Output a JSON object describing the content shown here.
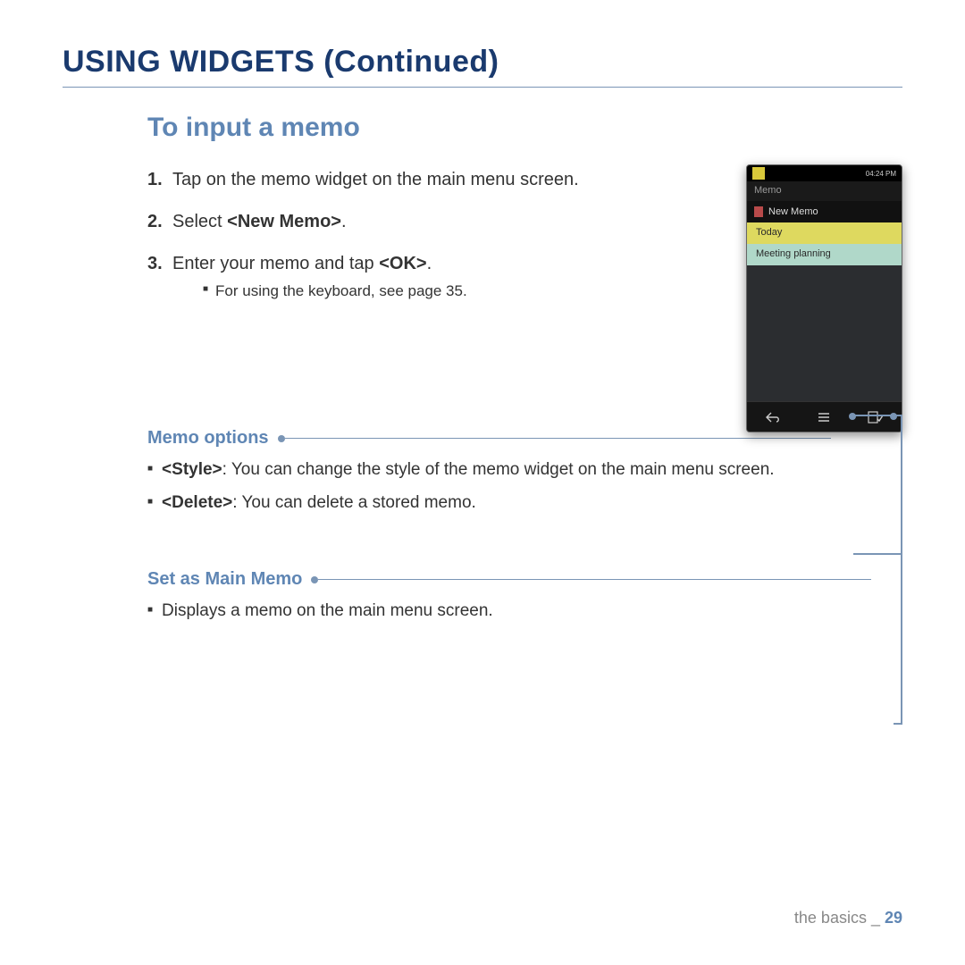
{
  "title": "USING WIDGETS (Continued)",
  "section": "To input a memo",
  "steps": [
    {
      "num": "1.",
      "text": "Tap on the memo widget on the main menu screen."
    },
    {
      "num": "2.",
      "prefix": "Select ",
      "bold": "<New Memo>",
      "suffix": "."
    },
    {
      "num": "3.",
      "prefix": "Enter your memo and tap ",
      "bold": "<OK>",
      "suffix": "."
    }
  ],
  "substep": "For using the keyboard, see page 35.",
  "memo_options": {
    "title": "Memo options",
    "items": [
      {
        "bold": "<Style>",
        "text": ": You can change the style of the memo widget on the main menu screen."
      },
      {
        "bold": "<Delete>",
        "text": ": You can delete a stored memo."
      }
    ]
  },
  "set_main": {
    "title": "Set as Main Memo",
    "items": [
      {
        "text": "Displays a memo on the main menu screen."
      }
    ]
  },
  "phone": {
    "time": "04:24 PM",
    "header": "Memo",
    "new_memo": "New Memo",
    "rows": [
      "Today",
      "Meeting planning"
    ]
  },
  "footer": {
    "section": "the basics",
    "sep": " _ ",
    "page": "29"
  }
}
